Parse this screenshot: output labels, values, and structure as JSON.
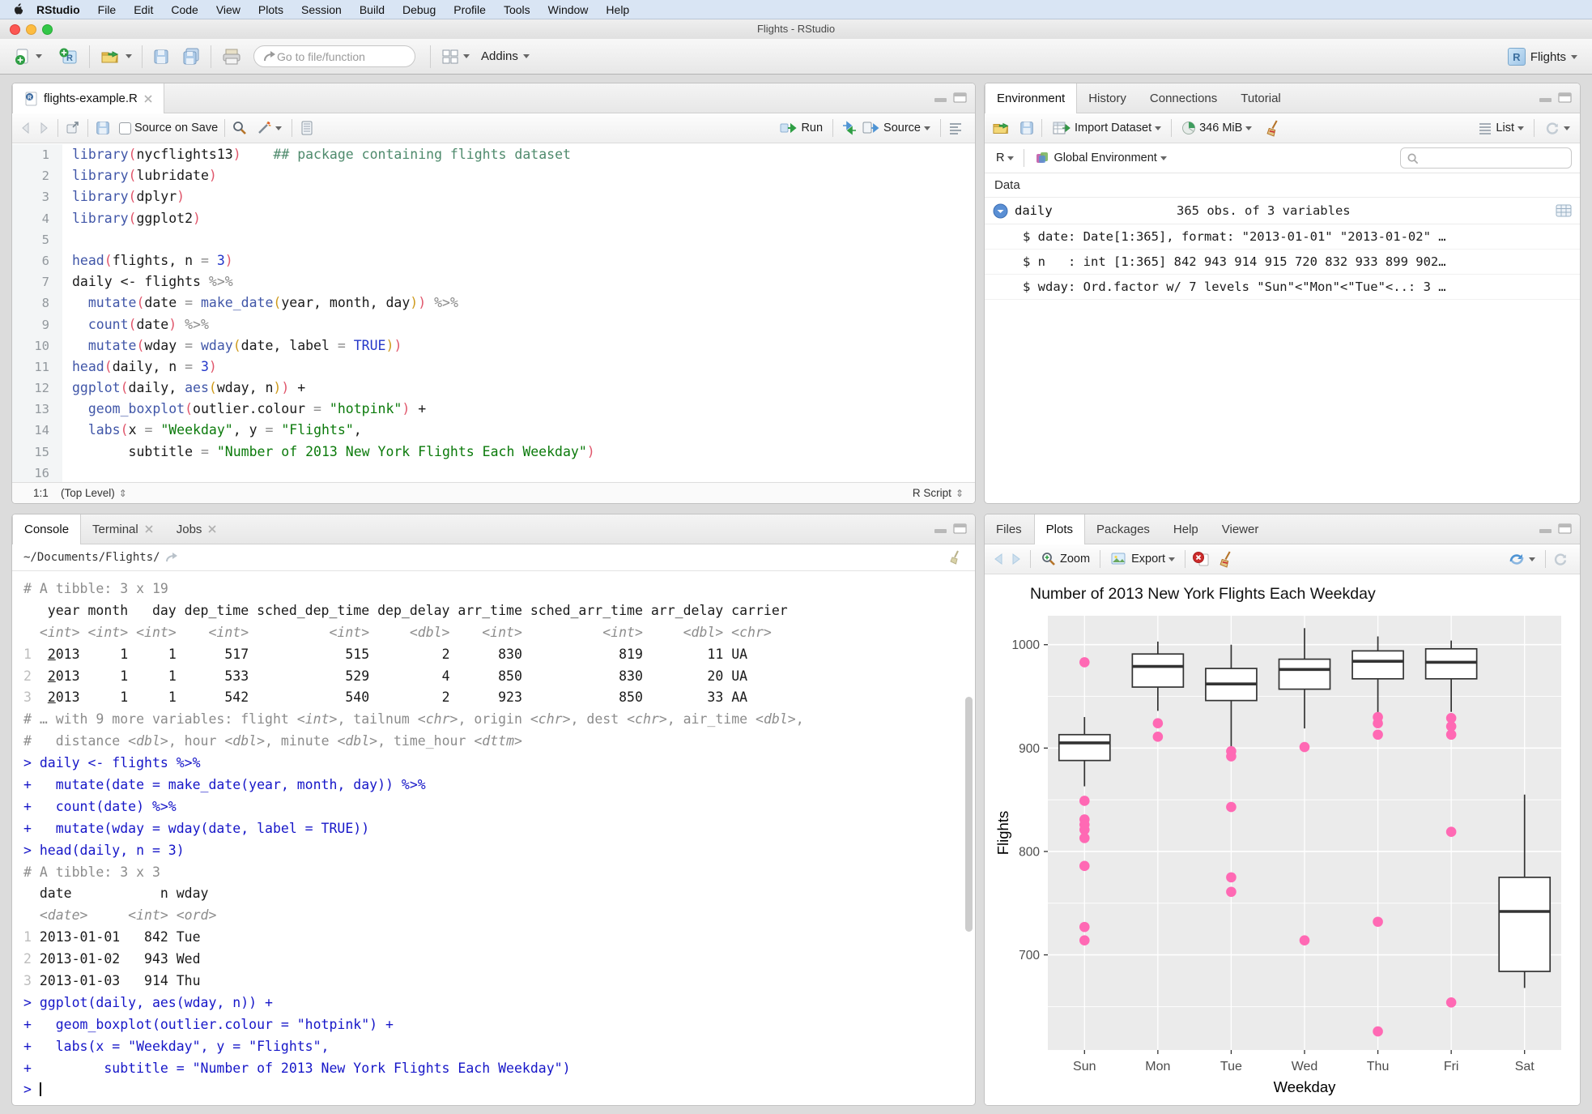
{
  "menu_bar": {
    "items": [
      "RStudio",
      "File",
      "Edit",
      "Code",
      "View",
      "Plots",
      "Session",
      "Build",
      "Debug",
      "Profile",
      "Tools",
      "Window",
      "Help"
    ]
  },
  "title_bar": {
    "title": "Flights - RStudio"
  },
  "main_toolbar": {
    "goto_placeholder": "Go to file/function",
    "addins_label": "Addins",
    "project_label": "Flights",
    "r_logo": "R"
  },
  "source_pane": {
    "tab": "flights-example.R",
    "source_on_save_label": "Source on Save",
    "run_label": "Run",
    "source_label": "Source",
    "status": {
      "position": "1:1",
      "scope": "(Top Level)",
      "type": "R Script",
      "updown": "⇕"
    },
    "code": [
      {
        "n": "1",
        "seg": [
          [
            "f",
            "library"
          ],
          [
            "p1",
            "("
          ],
          [
            null,
            "nycflights13"
          ],
          [
            "p1",
            ")"
          ],
          [
            null,
            "    "
          ],
          [
            "c",
            "## package containing flights dataset"
          ]
        ]
      },
      {
        "n": "2",
        "seg": [
          [
            "f",
            "library"
          ],
          [
            "p1",
            "("
          ],
          [
            null,
            "lubridate"
          ],
          [
            "p1",
            ")"
          ]
        ]
      },
      {
        "n": "3",
        "seg": [
          [
            "f",
            "library"
          ],
          [
            "p1",
            "("
          ],
          [
            null,
            "dplyr"
          ],
          [
            "p1",
            ")"
          ]
        ]
      },
      {
        "n": "4",
        "seg": [
          [
            "f",
            "library"
          ],
          [
            "p1",
            "("
          ],
          [
            null,
            "ggplot2"
          ],
          [
            "p1",
            ")"
          ]
        ]
      },
      {
        "n": "5",
        "seg": []
      },
      {
        "n": "6",
        "seg": [
          [
            "f",
            "head"
          ],
          [
            "p1",
            "("
          ],
          [
            null,
            "flights, n "
          ],
          [
            "o",
            "= "
          ],
          [
            "n2",
            "3"
          ],
          [
            "p1",
            ")"
          ]
        ]
      },
      {
        "n": "7",
        "seg": [
          [
            null,
            "daily <- flights "
          ],
          [
            "o",
            "%>%"
          ]
        ]
      },
      {
        "n": "8",
        "seg": [
          [
            null,
            "  "
          ],
          [
            "f",
            "mutate"
          ],
          [
            "p1",
            "("
          ],
          [
            null,
            "date "
          ],
          [
            "o",
            "= "
          ],
          [
            "f",
            "make_date"
          ],
          [
            "p2",
            "("
          ],
          [
            null,
            "year, month, day"
          ],
          [
            "p2",
            ")"
          ],
          [
            "p1",
            ")"
          ],
          [
            "o",
            " %>%"
          ]
        ]
      },
      {
        "n": "9",
        "seg": [
          [
            null,
            "  "
          ],
          [
            "f",
            "count"
          ],
          [
            "p1",
            "("
          ],
          [
            null,
            "date"
          ],
          [
            "p1",
            ")"
          ],
          [
            "o",
            " %>%"
          ]
        ]
      },
      {
        "n": "10",
        "seg": [
          [
            null,
            "  "
          ],
          [
            "f",
            "mutate"
          ],
          [
            "p1",
            "("
          ],
          [
            null,
            "wday "
          ],
          [
            "o",
            "= "
          ],
          [
            "f",
            "wday"
          ],
          [
            "p2",
            "("
          ],
          [
            null,
            "date, label "
          ],
          [
            "o",
            "= "
          ],
          [
            "n2",
            "TRUE"
          ],
          [
            "p2",
            ")"
          ],
          [
            "p1",
            ")"
          ]
        ]
      },
      {
        "n": "11",
        "seg": [
          [
            "f",
            "head"
          ],
          [
            "p1",
            "("
          ],
          [
            null,
            "daily, n "
          ],
          [
            "o",
            "= "
          ],
          [
            "n2",
            "3"
          ],
          [
            "p1",
            ")"
          ]
        ]
      },
      {
        "n": "12",
        "seg": [
          [
            "f",
            "ggplot"
          ],
          [
            "p1",
            "("
          ],
          [
            null,
            "daily, "
          ],
          [
            "f",
            "aes"
          ],
          [
            "p2",
            "("
          ],
          [
            null,
            "wday, n"
          ],
          [
            "p2",
            ")"
          ],
          [
            "p1",
            ")"
          ],
          [
            null,
            " +"
          ]
        ]
      },
      {
        "n": "13",
        "seg": [
          [
            null,
            "  "
          ],
          [
            "f",
            "geom_boxplot"
          ],
          [
            "p1",
            "("
          ],
          [
            null,
            "outlier.colour "
          ],
          [
            "o",
            "= "
          ],
          [
            "s",
            "\"hotpink\""
          ],
          [
            "p1",
            ")"
          ],
          [
            null,
            " +"
          ]
        ]
      },
      {
        "n": "14",
        "seg": [
          [
            null,
            "  "
          ],
          [
            "f",
            "labs"
          ],
          [
            "p1",
            "("
          ],
          [
            null,
            "x "
          ],
          [
            "o",
            "= "
          ],
          [
            "s",
            "\"Weekday\""
          ],
          [
            null,
            ", y "
          ],
          [
            "o",
            "= "
          ],
          [
            "s",
            "\"Flights\""
          ],
          [
            null,
            ","
          ]
        ]
      },
      {
        "n": "15",
        "seg": [
          [
            null,
            "       subtitle "
          ],
          [
            "o",
            "= "
          ],
          [
            "s",
            "\"Number of 2013 New York Flights Each Weekday\""
          ],
          [
            "p1",
            ")"
          ]
        ]
      },
      {
        "n": "16",
        "seg": []
      }
    ]
  },
  "console_pane": {
    "tabs": [
      {
        "label": "Console",
        "active": true,
        "closable": false
      },
      {
        "label": "Terminal",
        "active": false,
        "closable": true
      },
      {
        "label": "Jobs",
        "active": false,
        "closable": true
      }
    ],
    "working_dir": "~/Documents/Flights/",
    "lines": [
      [
        [
          "g",
          "# A tibble: 3 x 19"
        ]
      ],
      [
        [
          null,
          "   year month   day dep_time sched_dep_time dep_delay arr_time sched_arr_time arr_delay carrier"
        ]
      ],
      [
        [
          "gi",
          "  <int> <int> <int>    <int>          <int>     <dbl>    <int>          <int>     <dbl> <chr>"
        ]
      ],
      [
        [
          "rn",
          "1"
        ],
        [
          null,
          "  "
        ],
        [
          "u",
          "2"
        ],
        [
          null,
          "013     1     1      517            515         2      830            819        11 UA"
        ]
      ],
      [
        [
          "rn",
          "2"
        ],
        [
          null,
          "  "
        ],
        [
          "u",
          "2"
        ],
        [
          null,
          "013     1     1      533            529         4      850            830        20 UA"
        ]
      ],
      [
        [
          "rn",
          "3"
        ],
        [
          null,
          "  "
        ],
        [
          "u",
          "2"
        ],
        [
          null,
          "013     1     1      542            540         2      923            850        33 AA"
        ]
      ],
      [
        [
          "g",
          "# … with 9 more variables: flight "
        ],
        [
          "gi",
          "<int>"
        ],
        [
          "g",
          ", tailnum "
        ],
        [
          "gi",
          "<chr>"
        ],
        [
          "g",
          ", origin "
        ],
        [
          "gi",
          "<chr>"
        ],
        [
          "g",
          ", dest "
        ],
        [
          "gi",
          "<chr>"
        ],
        [
          "g",
          ", air_time "
        ],
        [
          "gi",
          "<dbl>"
        ],
        [
          "g",
          ","
        ]
      ],
      [
        [
          "g",
          "#   distance "
        ],
        [
          "gi",
          "<dbl>"
        ],
        [
          "g",
          ", hour "
        ],
        [
          "gi",
          "<dbl>"
        ],
        [
          "g",
          ", minute "
        ],
        [
          "gi",
          "<dbl>"
        ],
        [
          "g",
          ", time_hour "
        ],
        [
          "gi",
          "<dttm>"
        ]
      ],
      [
        [
          "b",
          "> daily <- flights %>%"
        ]
      ],
      [
        [
          "b",
          "+   mutate(date = make_date(year, month, day)) %>%"
        ]
      ],
      [
        [
          "b",
          "+   count(date) %>%"
        ]
      ],
      [
        [
          "b",
          "+   mutate(wday = wday(date, label = TRUE))"
        ]
      ],
      [
        [
          "b",
          "> head(daily, n = 3)"
        ]
      ],
      [
        [
          "g",
          "# A tibble: 3 x 3"
        ]
      ],
      [
        [
          null,
          "  date           n wday"
        ]
      ],
      [
        [
          "gi",
          "  <date>     <int> <ord>"
        ]
      ],
      [
        [
          "rn",
          "1"
        ],
        [
          null,
          " 2013-01-01   842 Tue"
        ]
      ],
      [
        [
          "rn",
          "2"
        ],
        [
          null,
          " 2013-01-02   943 Wed"
        ]
      ],
      [
        [
          "rn",
          "3"
        ],
        [
          null,
          " 2013-01-03   914 Thu"
        ]
      ],
      [
        [
          "b",
          "> ggplot(daily, aes(wday, n)) +"
        ]
      ],
      [
        [
          "b",
          "+   geom_boxplot(outlier.colour = \"hotpink\") +"
        ]
      ],
      [
        [
          "b",
          "+   labs(x = \"Weekday\", y = \"Flights\","
        ]
      ],
      [
        [
          "b",
          "+         subtitle = \"Number of 2013 New York Flights Each Weekday\")"
        ]
      ],
      [
        [
          "b",
          "> "
        ],
        [
          "cursor",
          ""
        ]
      ]
    ]
  },
  "environment_pane": {
    "tabs": [
      "Environment",
      "History",
      "Connections",
      "Tutorial"
    ],
    "active_tab": "Environment",
    "import_label": "Import Dataset",
    "memory_label": "346 MiB",
    "list_label": "List",
    "r_label": "R",
    "env_label": "Global Environment",
    "data_header": "Data",
    "object": {
      "name": "daily",
      "desc": "365 obs. of 3 variables"
    },
    "details": [
      "$ date: Date[1:365], format: \"2013-01-01\" \"2013-01-02\" …",
      "$ n   : int [1:365] 842 943 914 915 720 832 933 899 902…",
      "$ wday: Ord.factor w/ 7 levels \"Sun\"<\"Mon\"<\"Tue\"<..: 3 …"
    ]
  },
  "plots_pane": {
    "tabs": [
      "Files",
      "Plots",
      "Packages",
      "Help",
      "Viewer"
    ],
    "active_tab": "Plots",
    "zoom_label": "Zoom",
    "export_label": "Export"
  },
  "chart_data": {
    "type": "boxplot",
    "title": "Number of 2013 New York Flights Each Weekday",
    "xlabel": "Weekday",
    "ylabel": "Flights",
    "categories": [
      "Sun",
      "Mon",
      "Tue",
      "Wed",
      "Thu",
      "Fri",
      "Sat"
    ],
    "ylim": [
      608,
      1028
    ],
    "yticks": [
      700,
      800,
      900,
      1000
    ],
    "minor_ticks": [
      650,
      750,
      850,
      950
    ],
    "grid": true,
    "panel_background": "#EBEBEB",
    "gridline_color": "#FFFFFF",
    "box_color": "#333333",
    "outlier_color": "#FF69B4",
    "series": [
      {
        "category": "Sun",
        "whislo": 863,
        "q1": 888,
        "med": 905,
        "q3": 913,
        "whishi": 930,
        "outliers": [
          983,
          849,
          831,
          826,
          821,
          813,
          786,
          727,
          714
        ]
      },
      {
        "category": "Mon",
        "whislo": 936,
        "q1": 959,
        "med": 979,
        "q3": 991,
        "whishi": 1003,
        "outliers": [
          924,
          911
        ]
      },
      {
        "category": "Tue",
        "whislo": 900,
        "q1": 946,
        "med": 962,
        "q3": 977,
        "whishi": 1000,
        "outliers": [
          897,
          892,
          843,
          775,
          761
        ]
      },
      {
        "category": "Wed",
        "whislo": 919,
        "q1": 957,
        "med": 976,
        "q3": 986,
        "whishi": 1016,
        "outliers": [
          901,
          714
        ]
      },
      {
        "category": "Thu",
        "whislo": 933,
        "q1": 967,
        "med": 984,
        "q3": 994,
        "whishi": 1008,
        "outliers": [
          930,
          924,
          913,
          732,
          626
        ]
      },
      {
        "category": "Fri",
        "whislo": 935,
        "q1": 967,
        "med": 983,
        "q3": 996,
        "whishi": 1004,
        "outliers": [
          929,
          921,
          913,
          819,
          654
        ]
      },
      {
        "category": "Sat",
        "whislo": 668,
        "q1": 684,
        "med": 742,
        "q3": 775,
        "whishi": 855,
        "outliers": []
      }
    ]
  }
}
